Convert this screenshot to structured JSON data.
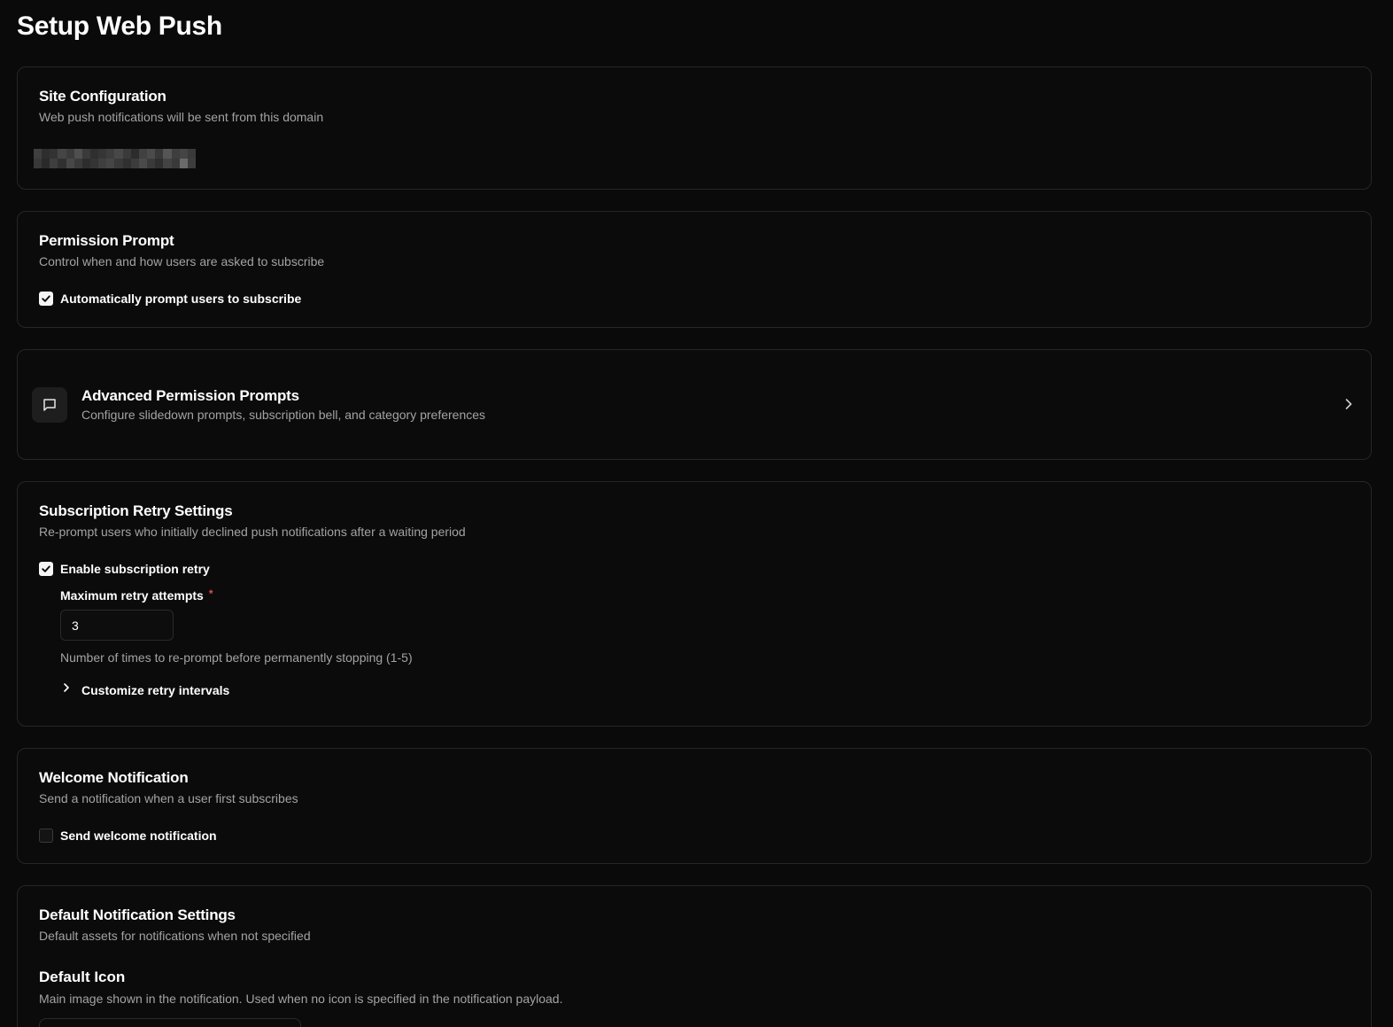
{
  "page": {
    "title": "Setup Web Push"
  },
  "site_config": {
    "title": "Site Configuration",
    "description": "Web push notifications will be sent from this domain"
  },
  "permission_prompt": {
    "title": "Permission Prompt",
    "description": "Control when and how users are asked to subscribe",
    "auto_prompt_label": "Automatically prompt users to subscribe",
    "auto_prompt_checked": true
  },
  "advanced_prompts": {
    "title": "Advanced Permission Prompts",
    "description": "Configure slidedown prompts, subscription bell, and category preferences",
    "icon": "message-square-icon",
    "nav_icon": "chevron-right-icon"
  },
  "retry_settings": {
    "title": "Subscription Retry Settings",
    "description": "Re-prompt users who initially declined push notifications after a waiting period",
    "enable_label": "Enable subscription retry",
    "enable_checked": true,
    "max_attempts_label": "Maximum retry attempts",
    "required_mark": "*",
    "max_attempts_value": "3",
    "max_attempts_help": "Number of times to re-prompt before permanently stopping (1-5)",
    "customize_label": "Customize retry intervals"
  },
  "welcome_notification": {
    "title": "Welcome Notification",
    "description": "Send a notification when a user first subscribes",
    "send_label": "Send welcome notification",
    "send_checked": false
  },
  "default_settings": {
    "title": "Default Notification Settings",
    "description": "Default assets for notifications when not specified",
    "icon_title": "Default Icon",
    "icon_description": "Main image shown in the notification. Used when no icon is specified in the notification payload."
  },
  "colors": {
    "background": "#0a0a0a",
    "card_border": "#262626",
    "text_primary": "#ffffff",
    "text_muted": "#a3a3a3",
    "required": "#e5484d"
  }
}
